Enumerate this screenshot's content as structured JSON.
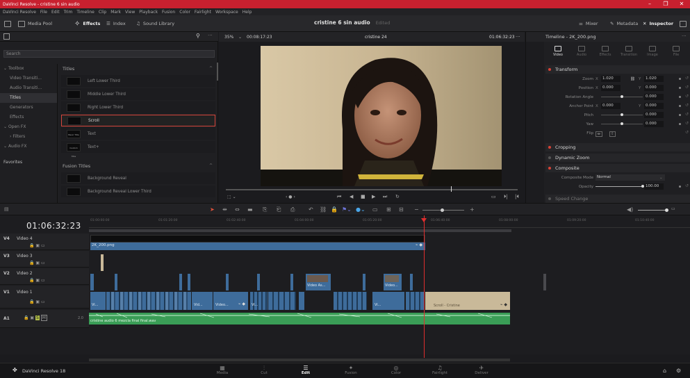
{
  "window": {
    "title": "DaVinci Resolve - cristine 6 sin audio",
    "controls": [
      "–",
      "❐",
      "✕"
    ]
  },
  "menu": [
    "DaVinci Resolve",
    "File",
    "Edit",
    "Trim",
    "Timeline",
    "Clip",
    "Mark",
    "View",
    "Playback",
    "Fusion",
    "Color",
    "Fairlight",
    "Workspace",
    "Help"
  ],
  "toolbar": {
    "media_pool": "Media Pool",
    "effects": "Effects",
    "index": "Index",
    "sound_library": "Sound Library",
    "project_name": "cristine 6 sin audio",
    "project_status": "Edited",
    "mixer": "Mixer",
    "metadata": "Metadata",
    "inspector": "Inspector"
  },
  "effects_panel": {
    "search_placeholder": "Search",
    "tree": [
      {
        "label": "Toolbox",
        "level": 0,
        "expanded": true
      },
      {
        "label": "Video Transiti...",
        "level": 1
      },
      {
        "label": "Audio Transiti...",
        "level": 1
      },
      {
        "label": "Titles",
        "level": 1,
        "selected": true
      },
      {
        "label": "Generators",
        "level": 1
      },
      {
        "label": "Effects",
        "level": 1
      },
      {
        "label": "Open FX",
        "level": 0,
        "expanded": true
      },
      {
        "label": "Filters",
        "level": 1
      },
      {
        "label": "Audio FX",
        "level": 0,
        "expanded": true
      }
    ],
    "favorites_label": "Favorites",
    "titles_header": "Titles",
    "titles": [
      {
        "label": "Left Lower Third",
        "thumb": ""
      },
      {
        "label": "Middle Lower Third",
        "thumb": ""
      },
      {
        "label": "Right Lower Third",
        "thumb": ""
      },
      {
        "label": "Scroll",
        "thumb": "",
        "selected": true
      },
      {
        "label": "Text",
        "thumb": "Basic Title"
      },
      {
        "label": "Text+",
        "thumb": "Custom Title"
      }
    ],
    "fusion_header": "Fusion Titles",
    "fusion_titles": [
      {
        "label": "Background Reveal"
      },
      {
        "label": "Background Reveal Lower Third"
      }
    ]
  },
  "viewer": {
    "zoom": "35%",
    "source_timecode": "00:08:17:23",
    "timeline_name": "cristine 24",
    "record_timecode": "01:06:32:23",
    "scrub_position": 0.8
  },
  "inspector": {
    "header": "Timeline - 2K_200.png",
    "tabs": [
      "Video",
      "Audio",
      "Effects",
      "Transition",
      "Image",
      "File"
    ],
    "active_tab": "Video",
    "transform_label": "Transform",
    "rows": [
      {
        "label": "Zoom",
        "x_label": "X",
        "x": "1.020",
        "y_label": "Y",
        "y": "1.020"
      },
      {
        "label": "Position",
        "x_label": "X",
        "x": "0.000",
        "y_label": "Y",
        "y": "0.000"
      },
      {
        "label": "Rotation Angle",
        "value": "0.000"
      },
      {
        "label": "Anchor Point",
        "x_label": "X",
        "x": "0.000",
        "y_label": "Y",
        "y": "0.000"
      },
      {
        "label": "Pitch",
        "value": "0.000"
      },
      {
        "label": "Yaw",
        "value": "0.000"
      },
      {
        "label": "Flip"
      }
    ],
    "cropping_label": "Cropping",
    "dynamic_zoom_label": "Dynamic Zoom",
    "composite_label": "Composite",
    "composite_mode_label": "Composite Mode",
    "composite_mode": "Normal",
    "opacity_label": "Opacity",
    "opacity": "100.00",
    "speed_change_label": "Speed Change"
  },
  "timeline": {
    "timecode": "01:06:32:23",
    "ruler": [
      "01:00:00:00",
      "01:01:20:00",
      "01:02:40:00",
      "01:04:00:00",
      "01:05:20:00",
      "01:06:40:00",
      "01:08:00:00",
      "01:09:20:00",
      "01:10:40:00"
    ],
    "tracks": [
      {
        "id": "V4",
        "name": "Video 4"
      },
      {
        "id": "V3",
        "name": "Video 3"
      },
      {
        "id": "V2",
        "name": "Video 2"
      },
      {
        "id": "V1",
        "name": "Video 1"
      },
      {
        "id": "A1",
        "name": "2.0"
      }
    ],
    "clips": {
      "v4_label": "2K_200.png",
      "v2_label_1": "Video As...",
      "v2_label_2": "Video...",
      "v1_label_1": "Vi...",
      "v1_label_2": "Vid...",
      "v1_label_3": "Video...",
      "v1_label_4": "Vi...",
      "v1_label_5": "Vi...",
      "v1_label_6": "Scroll - Cristine",
      "a1_label": "cristine audio 6 mezcla final final.wav"
    },
    "colors": {
      "video": "#3e6c9b",
      "audio": "#3a9d56",
      "title": "#c9b999",
      "playhead": "#e02e2e",
      "selection": "#d6463c"
    }
  },
  "pages": [
    {
      "label": "Media",
      "icon": "▦"
    },
    {
      "label": "Cut",
      "icon": "⫶"
    },
    {
      "label": "Edit",
      "icon": "☰",
      "active": true
    },
    {
      "label": "Fusion",
      "icon": "✦"
    },
    {
      "label": "Color",
      "icon": "◎"
    },
    {
      "label": "Fairlight",
      "icon": "♫"
    },
    {
      "label": "Deliver",
      "icon": "✈"
    }
  ],
  "brand": "DaVinci Resolve 18"
}
